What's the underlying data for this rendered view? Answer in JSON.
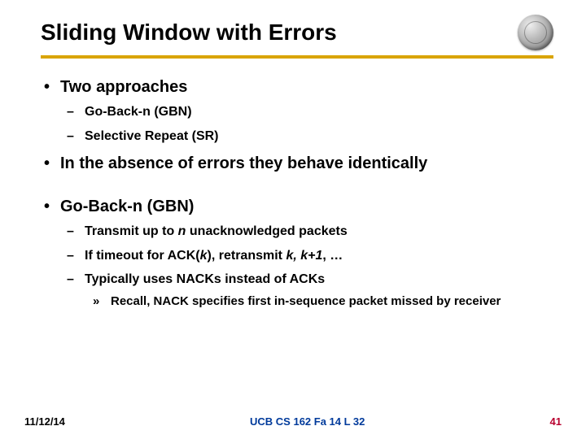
{
  "title": "Sliding Window with Errors",
  "bullets": {
    "b1": "Two approaches",
    "b1a": "Go-Back-n (GBN)",
    "b1b": "Selective Repeat (SR)",
    "b2": "In the absence of errors they behave identically",
    "b3": "Go-Back-n (GBN)",
    "b3a_pre": "Transmit up to ",
    "b3a_it": "n",
    "b3a_post": " unacknowledged packets",
    "b3b_pre": "If timeout for ACK(",
    "b3b_k": "k",
    "b3b_mid": "), retransmit ",
    "b3b_k2": "k, k+1",
    "b3b_post": ", …",
    "b3c": "Typically uses NACKs instead of ACKs",
    "b3c1": "Recall, NACK specifies first in-sequence packet missed by receiver"
  },
  "footer": {
    "date": "11/12/14",
    "course": "UCB CS 162 Fa 14 L 32",
    "page": "41"
  }
}
